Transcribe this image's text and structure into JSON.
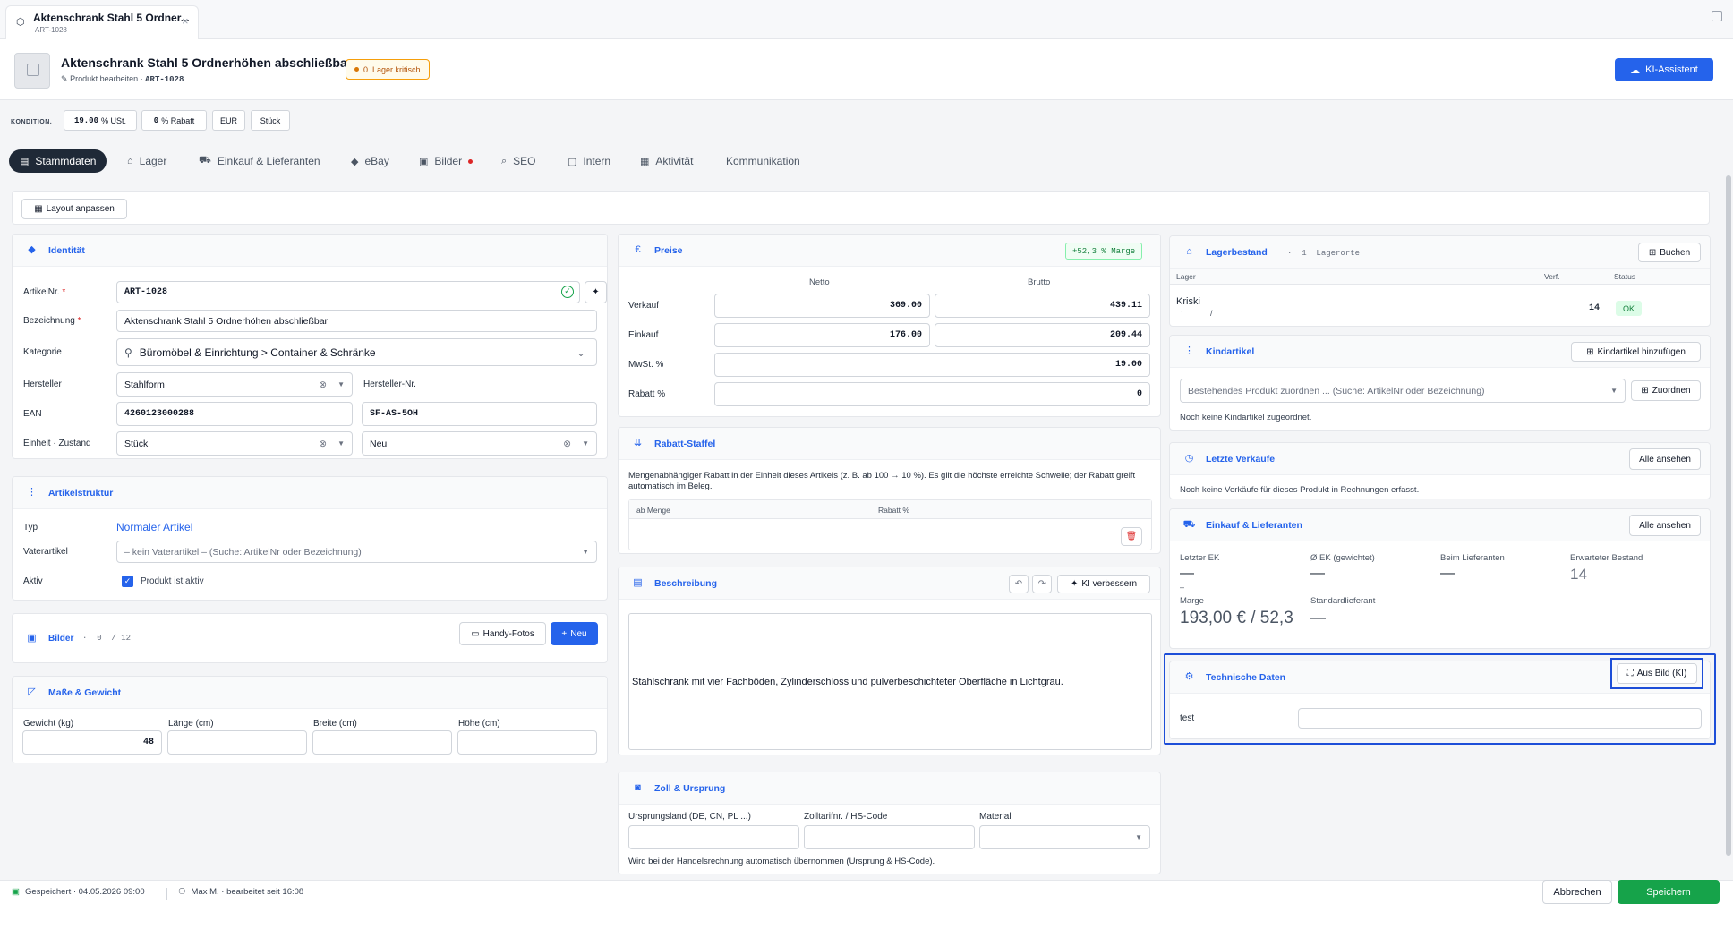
{
  "window_tab": {
    "title": "Aktenschrank Stahl 5 Ordner...",
    "subtitle": "ART-1028"
  },
  "header": {
    "title": "Aktenschrank Stahl 5 Ordnerhöhen abschließbar",
    "edit_label": "Produkt bearbeiten ·",
    "art_nr": "ART-1028",
    "stock_badge_count": "0",
    "stock_badge_label": "Lager kritisch",
    "ki_button": "KI-Assistent"
  },
  "konditionen": {
    "label": "KONDITION.",
    "ust_value": "19.00",
    "ust_unit": "% USt.",
    "rabatt_value": "0",
    "rabatt_unit": "% Rabatt",
    "currency": "EUR",
    "unit": "Stück"
  },
  "tabs": [
    {
      "label": "Stammdaten",
      "icon": "document-icon"
    },
    {
      "label": "Lager",
      "icon": "warehouse-icon"
    },
    {
      "label": "Einkauf & Lieferanten",
      "icon": "cart-icon"
    },
    {
      "label": "eBay",
      "icon": "tag-icon"
    },
    {
      "label": "Bilder",
      "icon": "image-icon"
    },
    {
      "label": "SEO",
      "icon": "search-icon"
    },
    {
      "label": "Intern",
      "icon": "file-icon"
    },
    {
      "label": "Aktivität",
      "icon": "activity-icon"
    },
    {
      "label": "Kommunikation",
      "icon": ""
    }
  ],
  "layout_button": "Layout anpassen",
  "identitaet": {
    "title": "Identität",
    "artikelnr_label": "ArtikelNr.",
    "artikelnr_value": "ART-1028",
    "bezeichnung_label": "Bezeichnung",
    "bezeichnung_value": "Aktenschrank Stahl 5 Ordnerhöhen abschließbar",
    "kategorie_label": "Kategorie",
    "kategorie_value": "Büromöbel & Einrichtung > Container & Schränke",
    "hersteller_label": "Hersteller",
    "hersteller_value": "Stahlform",
    "herstellernr_label": "Hersteller-Nr.",
    "ean_label": "EAN",
    "ean_value": "4260123000288",
    "herstellernr_value": "SF-AS-5OH",
    "einheit_label": "Einheit · Zustand",
    "einheit_value": "Stück",
    "zustand_value": "Neu"
  },
  "artikelstruktur": {
    "title": "Artikelstruktur",
    "typ_label": "Typ",
    "typ_value": "Normaler Artikel",
    "vater_label": "Vaterartikel",
    "vater_placeholder": "– kein Vaterartikel – (Suche: ArtikelNr oder Bezeichnung)",
    "aktiv_label": "Aktiv",
    "aktiv_checkbox": "Produkt ist aktiv"
  },
  "bilder": {
    "title": "Bilder",
    "count": "0",
    "max": "12",
    "handy": "Handy-Fotos",
    "neu": "Neu"
  },
  "masse": {
    "title": "Maße & Gewicht",
    "gewicht_label": "Gewicht (kg)",
    "gewicht_value": "48",
    "laenge_label": "Länge (cm)",
    "breite_label": "Breite (cm)",
    "hoehe_label": "Höhe (cm)"
  },
  "preise": {
    "title": "Preise",
    "marge_badge": "+52,3 % Marge",
    "netto_header": "Netto",
    "brutto_header": "Brutto",
    "verkauf_label": "Verkauf",
    "verkauf_netto": "369.00",
    "verkauf_brutto": "439.11",
    "einkauf_label": "Einkauf",
    "einkauf_netto": "176.00",
    "einkauf_brutto": "209.44",
    "mwst_label": "MwSt. %",
    "mwst_value": "19.00",
    "rabatt_label": "Rabatt %",
    "rabatt_value": "0"
  },
  "staffel": {
    "title": "Rabatt-Staffel",
    "description": "Mengenabhängiger Rabatt in der Einheit dieses Artikels (z. B. ab 100 → 10 %). Es gilt die höchste erreichte Schwelle; der Rabatt greift automatisch im Beleg.",
    "col_menge": "ab Menge",
    "col_rabatt": "Rabatt %"
  },
  "beschreibung": {
    "title": "Beschreibung",
    "ki_button": "KI verbessern",
    "text": "Stahlschrank mit vier Fachböden, Zylinderschloss und pulverbeschichteter Oberfläche in Lichtgrau."
  },
  "zoll": {
    "title": "Zoll & Ursprung",
    "ursprung_label": "Ursprungsland (DE, CN, PL ...)",
    "zolltarif_label": "Zolltarifnr. / HS-Code",
    "material_label": "Material",
    "hint": "Wird bei der Handelsrechnung automatisch übernommen (Ursprung & HS-Code)."
  },
  "lager": {
    "title": "Lagerbestand",
    "orte_count": "1",
    "orte_label": "Lagerorte",
    "buchen": "Buchen",
    "col_lager": "Lager",
    "col_verf": "Verf.",
    "col_status": "Status",
    "row_name": "Kriski",
    "row_sub": "·",
    "row_sub2": "/",
    "row_verf": "14",
    "row_status": "OK"
  },
  "kindartikel": {
    "title": "Kindartikel",
    "add_button": "Kindartikel hinzufügen",
    "placeholder": "Bestehendes Produkt zuordnen ... (Suche: ArtikelNr oder Bezeichnung)",
    "assign_button": "Zuordnen",
    "empty": "Noch keine Kindartikel zugeordnet."
  },
  "verkaeufe": {
    "title": "Letzte Verkäufe",
    "all_button": "Alle ansehen",
    "empty": "Noch keine Verkäufe für dieses Produkt in Rechnungen erfasst."
  },
  "einkauf": {
    "title": "Einkauf & Lieferanten",
    "all_button": "Alle ansehen",
    "letzter_ek_label": "Letzter EK",
    "letzter_ek_value": "—",
    "letzter_ek_sub": "–",
    "ek_gew_label": "Ø EK (gewichtet)",
    "ek_gew_value": "—",
    "beim_lief_label": "Beim Lieferanten",
    "beim_lief_value": "—",
    "erw_label": "Erwarteter Bestand",
    "erw_value": "14",
    "marge_label": "Marge",
    "marge_value": "193,00 € / 52,3",
    "std_lief_label": "Standardlieferant",
    "std_lief_value": "—"
  },
  "technisch": {
    "title": "Technische Daten",
    "aus_bild": "Aus Bild (KI)",
    "row_label": "test"
  },
  "footer": {
    "saved": "Gespeichert · 04.05.2026 09:00",
    "user": "Max M. · bearbeitet seit 16:08",
    "cancel": "Abbrechen",
    "save": "Speichern"
  },
  "colors": {
    "accent": "#2563eb",
    "save": "#16a34a",
    "warn": "#f59e0b",
    "highlight": "#1d4ed8"
  }
}
